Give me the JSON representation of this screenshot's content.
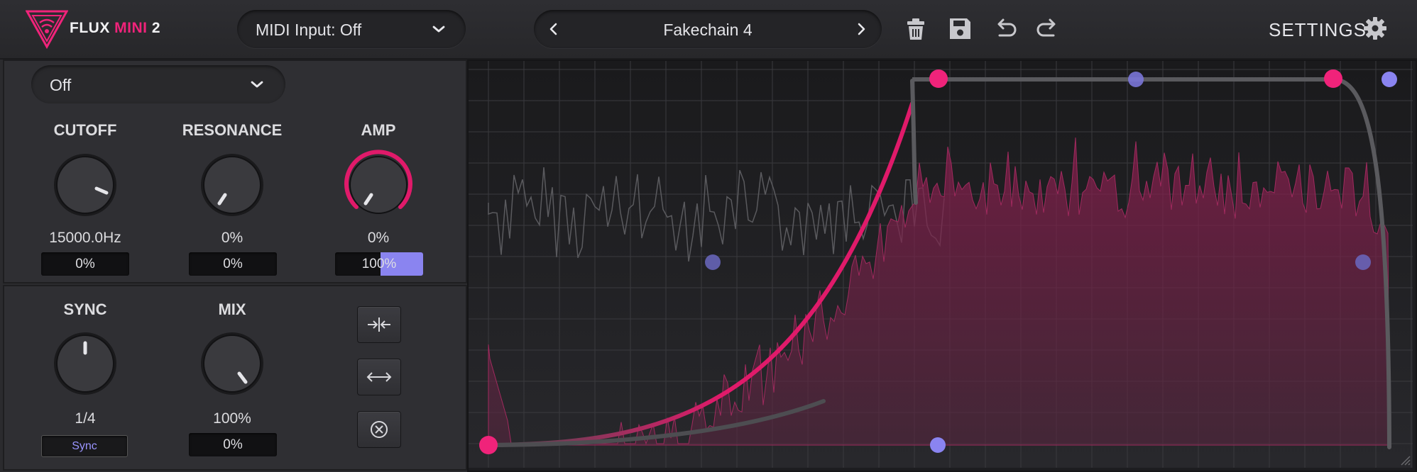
{
  "header": {
    "brand": {
      "name": "FLUX",
      "accent": "MINI",
      "version": "2"
    },
    "midi_input_label": "MIDI Input: Off",
    "preset_name": "Fakechain 4",
    "settings_label": "SETTINGS"
  },
  "left_panel": {
    "source_select": "Off",
    "knobs_top": [
      {
        "label": "CUTOFF",
        "value": "15000.0Hz",
        "box": "0%",
        "level": 0.78
      },
      {
        "label": "RESONANCE",
        "value": "0%",
        "box": "0%",
        "level": 0.0
      },
      {
        "label": "AMP",
        "value": "0%",
        "box": "100%",
        "level": 0.0,
        "box_fill": 0.48
      }
    ],
    "knobs_bottom": [
      {
        "label": "SYNC",
        "value": "1/4",
        "box": "Sync",
        "level": 0.5
      },
      {
        "label": "MIX",
        "value": "100%",
        "box": "0%",
        "level": 1.0
      }
    ]
  },
  "colors": {
    "accent_pink": "#f0237a",
    "accent_purple": "#8a84f0",
    "knob_ring": "#e01a6a",
    "background": "#2b2b2e"
  },
  "icons": {
    "logo": "flux-triangle-logo",
    "midi_dropdown": "chevron-down-icon",
    "prev": "chevron-left-icon",
    "next": "chevron-right-icon",
    "delete": "trash-icon",
    "save": "floppy-disk-icon",
    "undo": "undo-icon",
    "redo": "redo-icon",
    "settings": "gear-icon",
    "btn1": "compress-icon",
    "btn2": "expand-horizontal-icon",
    "btn3": "clear-circle-icon"
  }
}
